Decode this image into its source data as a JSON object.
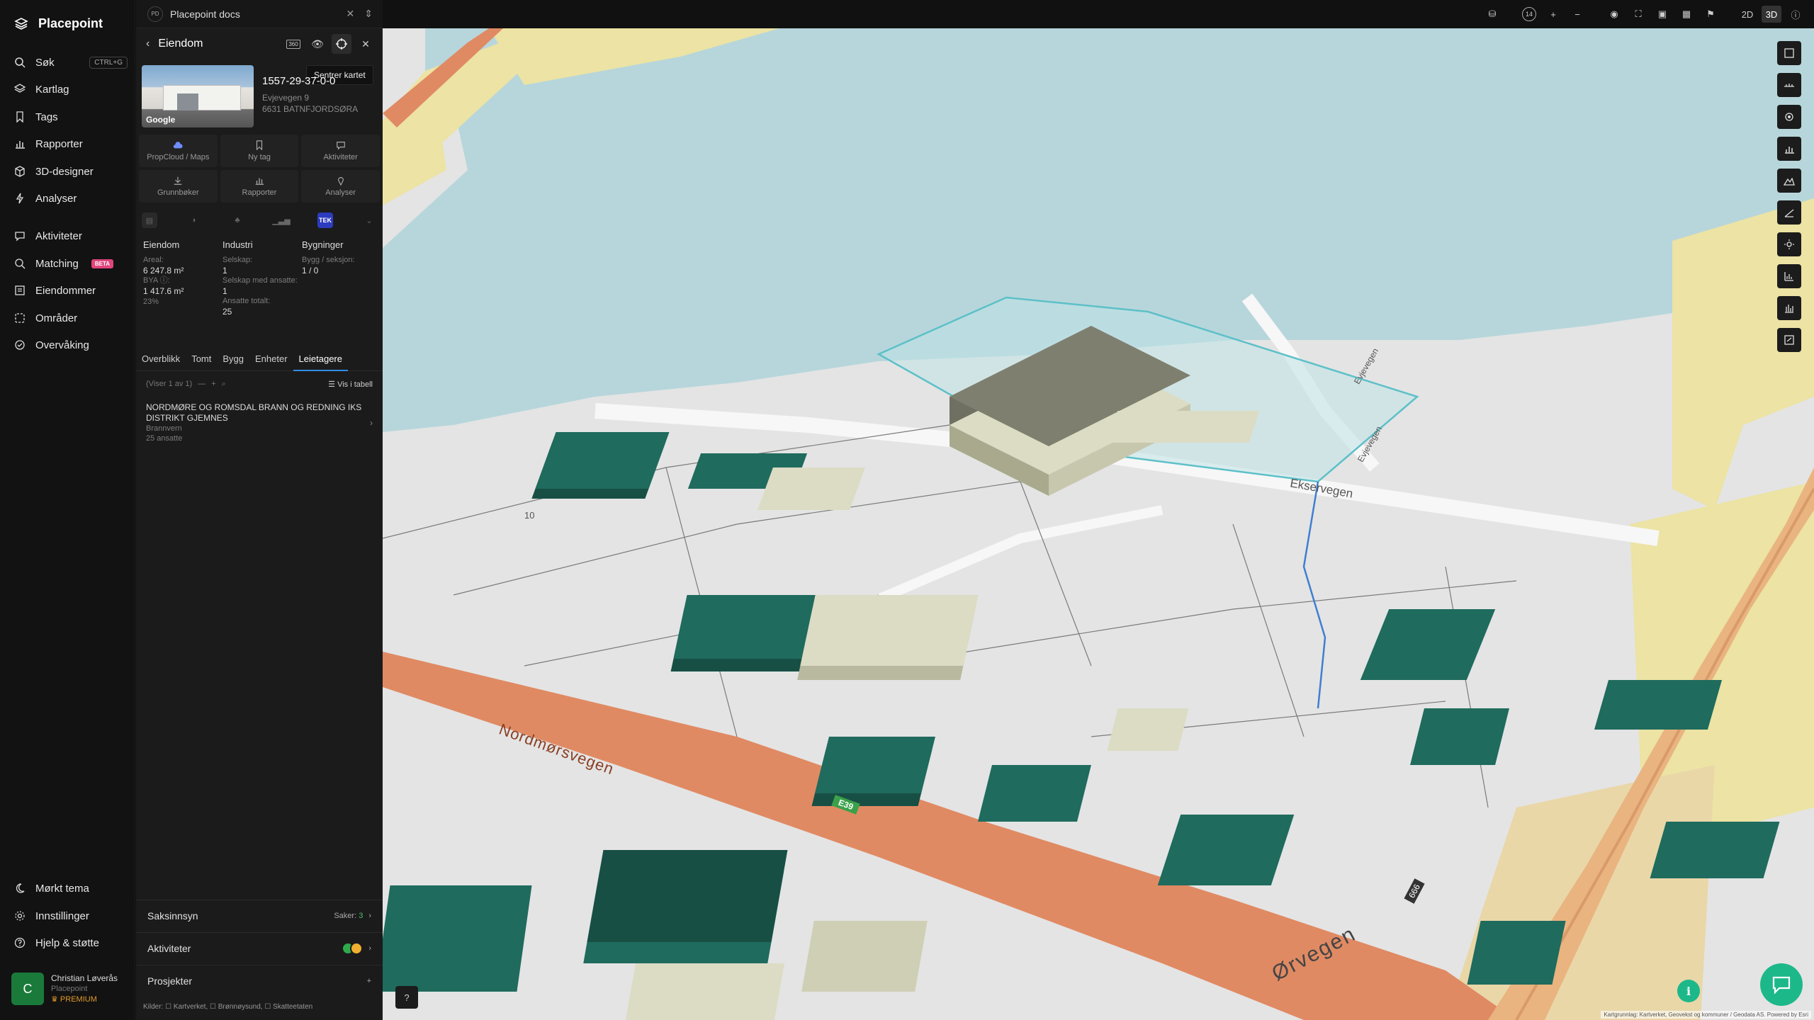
{
  "app": {
    "name": "Placepoint"
  },
  "nav": {
    "items": [
      {
        "label": "Søk",
        "shortcut": "CTRL+G"
      },
      {
        "label": "Kartlag"
      },
      {
        "label": "Tags"
      },
      {
        "label": "Rapporter"
      },
      {
        "label": "3D-designer"
      },
      {
        "label": "Analyser"
      },
      {
        "label": "Aktiviteter"
      },
      {
        "label": "Matching",
        "badge": "BETA"
      },
      {
        "label": "Eiendommer"
      },
      {
        "label": "Områder"
      },
      {
        "label": "Overvåking"
      }
    ],
    "bottom": [
      {
        "label": "Mørkt tema"
      },
      {
        "label": "Innstillinger"
      },
      {
        "label": "Hjelp & støtte"
      }
    ],
    "user": {
      "initial": "C",
      "name": "Christian Løverås",
      "org": "Placepoint",
      "plan": "PREMIUM"
    }
  },
  "panel": {
    "tab": {
      "badge": "PD",
      "title": "Placepoint docs"
    },
    "header": {
      "title": "Eiendom",
      "badge360": "360"
    },
    "tooltip": "Sentrer kartet",
    "property": {
      "photo_label": "Google",
      "id": "1557-29-37-0-0",
      "street": "Evjevegen 9",
      "postal": "6631 BATNFJORDSØRA"
    },
    "actions": [
      {
        "label": "PropCloud / Maps"
      },
      {
        "label": "Ny tag"
      },
      {
        "label": "Aktiviteter"
      },
      {
        "label": "Grunnbøker"
      },
      {
        "label": "Rapporter"
      },
      {
        "label": "Analyser"
      }
    ],
    "tek_label": "TEK",
    "stats": {
      "eiendom": {
        "title": "Eiendom",
        "areal_label": "Areal:",
        "areal": "6 247.8 m²",
        "bya_label": "BYA ⓘ:",
        "bya": "1 417.6 m²",
        "pct": "23%"
      },
      "industri": {
        "title": "Industri",
        "selskap_label": "Selskap:",
        "selskap": "1",
        "ansatte_label": "Selskap med ansatte:",
        "ansatte": "1",
        "totalt_label": "Ansatte totalt:",
        "totalt": "25"
      },
      "bygninger": {
        "title": "Bygninger",
        "label": "Bygg / seksjon:",
        "value": "1 / 0"
      }
    },
    "tabs": [
      "Overblikk",
      "Tomt",
      "Bygg",
      "Enheter",
      "Leietagere"
    ],
    "toolbar": {
      "count": "(Viser 1 av 1)",
      "table": "Vis i tabell"
    },
    "tenant": {
      "name": "NORDMØRE OG ROMSDAL BRANN OG REDNING IKS DISTRIKT GJEMNES",
      "category": "Brannvern",
      "employees": "25 ansatte"
    },
    "sections": {
      "saksinnsyn": {
        "label": "Saksinnsyn",
        "meta_label": "Saker:",
        "meta_value": "3"
      },
      "aktiviteter": {
        "label": "Aktiviteter"
      },
      "prosjekter": {
        "label": "Prosjekter"
      }
    },
    "sources": "Kilder: ☐ Kartverket, ☐ Brønnøysund, ☐ Skatteetaten"
  },
  "topbar": {
    "zoom": "14",
    "mode2d": "2D",
    "mode3d": "3D"
  },
  "map": {
    "labels": {
      "road1": "Nordmørsvegen",
      "road2": "Ørvegen",
      "road3": "Ekservegen",
      "road4": "Evjevegen",
      "road5": "Evjevegen",
      "e39": "E39",
      "r666": "666",
      "n10": "10"
    },
    "credit": "Kartgrunnlag: Kartverket, Geovekst og kommuner / Geodata AS. Powered by Esri"
  },
  "colors": {
    "accent": "#2f8fe8",
    "teal": "#1f6b5e",
    "water": "#b7d6db",
    "road": "#e08a63",
    "grass": "#ece3a4"
  }
}
